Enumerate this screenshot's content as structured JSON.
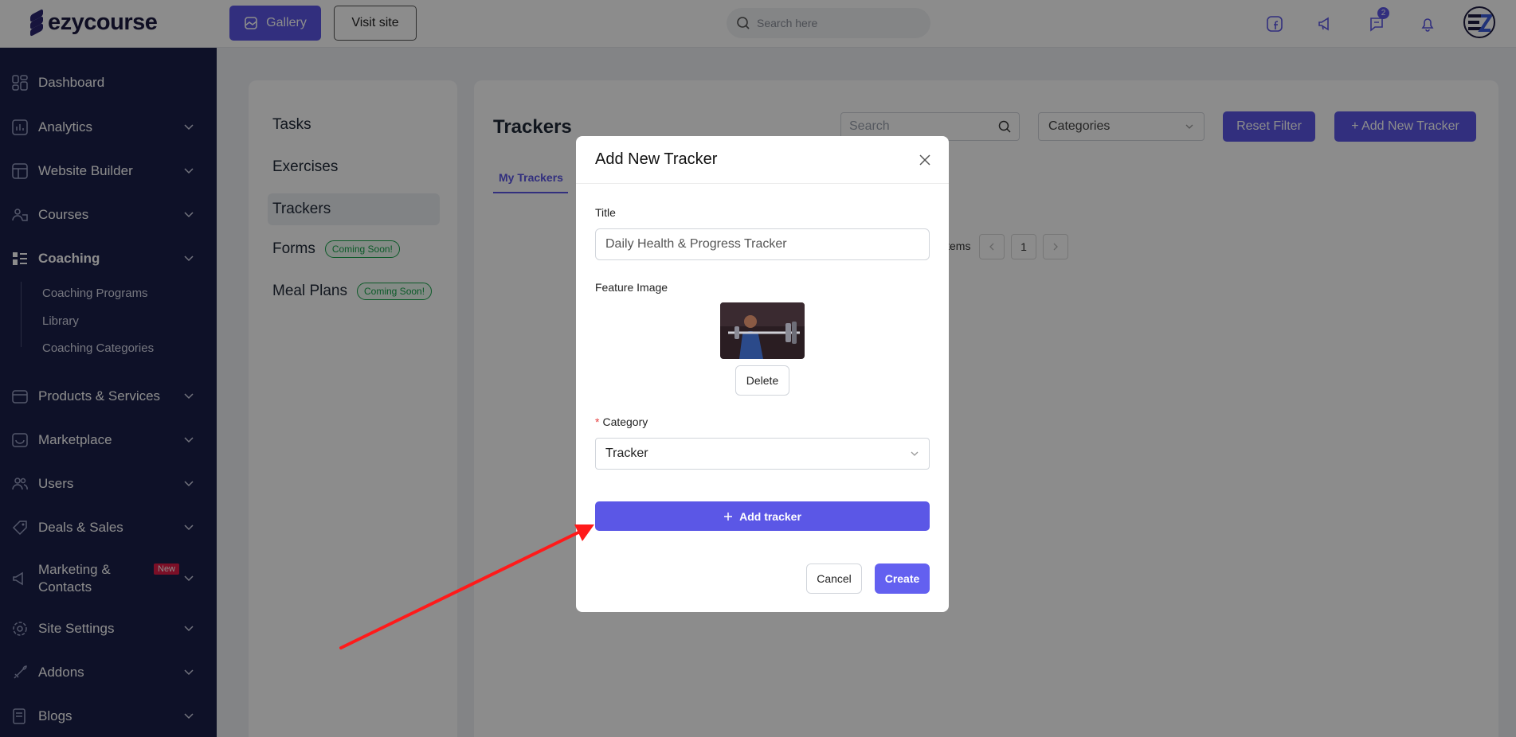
{
  "brand": {
    "name": "ezycourse"
  },
  "topbar": {
    "gallery_label": "Gallery",
    "visit_label": "Visit site",
    "search_placeholder": "Search here",
    "messages_badge": "2"
  },
  "sidebar": {
    "items": [
      {
        "label": "Dashboard"
      },
      {
        "label": "Analytics"
      },
      {
        "label": "Website Builder"
      },
      {
        "label": "Courses"
      },
      {
        "label": "Coaching"
      },
      {
        "label": "Products & Services"
      },
      {
        "label": "Marketplace"
      },
      {
        "label": "Users"
      },
      {
        "label": "Deals & Sales"
      },
      {
        "label": "Marketing &"
      },
      {
        "label": "Site Settings"
      },
      {
        "label": "Addons"
      },
      {
        "label": "Blogs"
      }
    ],
    "marketing_line2": "Contacts",
    "new_badge": "New",
    "coaching_sub": [
      "Coaching Programs",
      "Library",
      "Coaching Categories"
    ]
  },
  "left_panel": {
    "items": [
      "Tasks",
      "Exercises",
      "Trackers",
      "Forms",
      "Meal Plans"
    ],
    "coming_soon": "Coming Soon!"
  },
  "main": {
    "title": "Trackers",
    "search_placeholder": "Search",
    "categories_label": "Categories",
    "reset_label": "Reset Filter",
    "add_label": "+ Add New Tracker",
    "tab_label": "My Trackers",
    "items_text": "items",
    "page": "1"
  },
  "modal": {
    "title": "Add New Tracker",
    "title_label": "Title",
    "title_value": "Daily Health & Progress Tracker",
    "feature_label": "Feature Image",
    "delete_label": "Delete",
    "category_label": "Category",
    "category_value": "Tracker",
    "add_tracker_label": "Add tracker",
    "cancel_label": "Cancel",
    "create_label": "Create"
  },
  "colors": {
    "accent": "#5b57e6",
    "sidebar": "#1a1f4a",
    "annotation_arrow": "#ff1a1a"
  }
}
